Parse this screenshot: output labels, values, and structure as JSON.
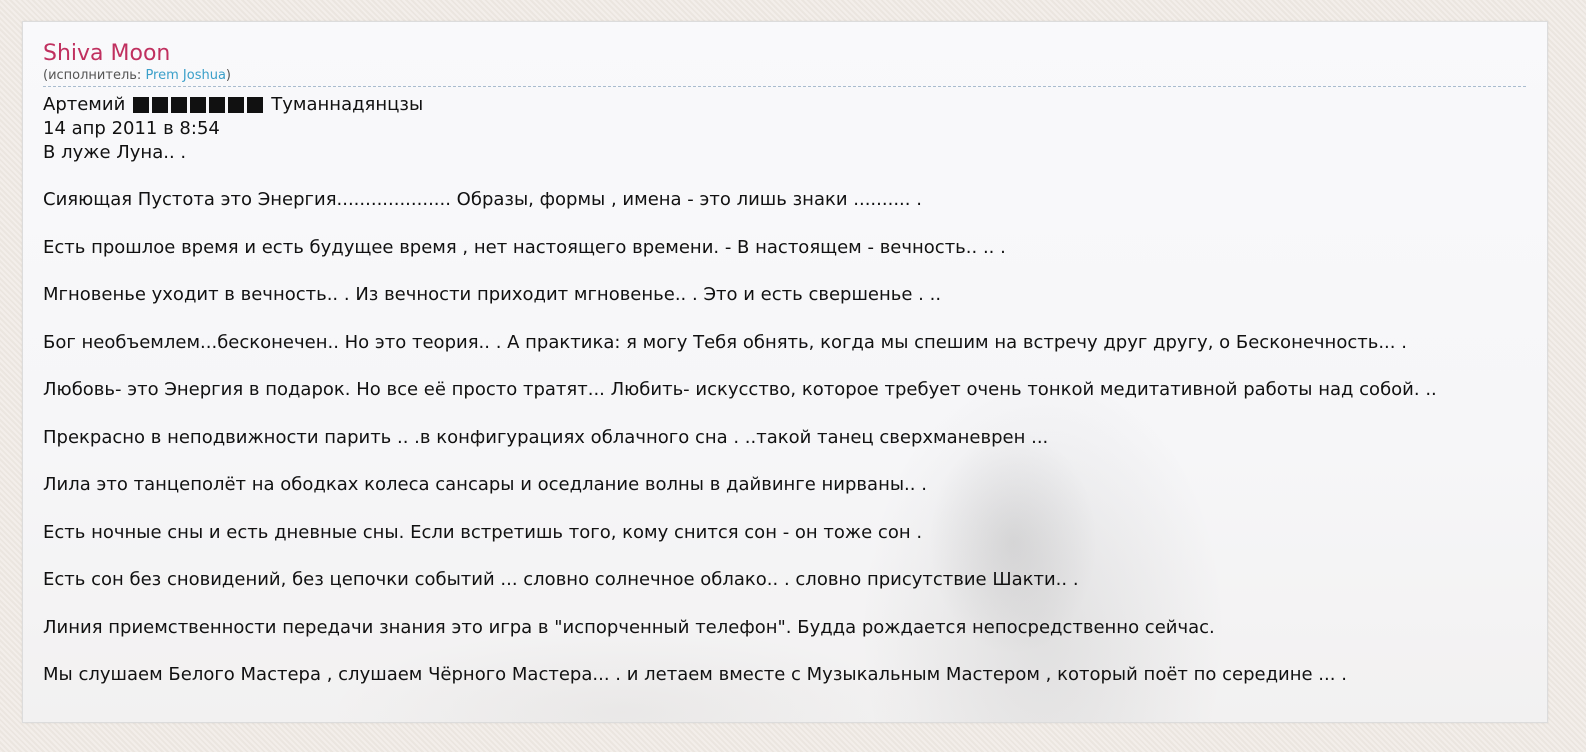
{
  "song": {
    "title": "Shiva Moon",
    "performer_prefix": "(исполнитель: ",
    "performer_name": "Prem Joshua",
    "performer_suffix": ")"
  },
  "post": {
    "author_first": "Артемий",
    "author_last": "Туманнадянцзы",
    "date": "14 апр 2011 в 8:54",
    "lines": [
      "В луже Луна.. .",
      "Сияющая Пустота это Энергия.................... Образы, формы , имена - это лишь знаки .......... .",
      "Есть прошлое время и есть будущее время , нет настоящего времени. - В настоящем - вечность.. .. .",
      "Мгновенье уходит в вечность.. . Из вечности приходит мгновенье.. . Это и есть свершенье . ..",
      "Бог необъемлем...бесконечен.. Но это теория.. . А практика: я могу Тебя обнять, когда мы спешим на встречу друг другу, о Бесконечность... .",
      "Любовь- это Энергия в подарок. Но все её просто тратят... Любить- искусство, которое требует очень тонкой медитативной работы над собой. ..",
      "Прекрасно в неподвижности парить .. .в конфигурациях облачного сна . ..такой танец сверхманеврен ...",
      "Лила это танцеполёт на ободках колеса сансары и оседлание волны в дайвинге нирваны.. .",
      "Есть ночные сны и есть дневные сны. Если встретишь того, кому снится сон - он тоже сон .",
      "Есть сон без сновидений, без цепочки событий ... словно солнечное облако.. . словно присутствие Шакти.. .",
      "Линия приемственности передачи знания это игра в \"испорченный телефон\". Будда рождается непосредственно сейчас.",
      "Мы слушаем Белого Мастера , слушаем Чёрного Мастера... . и летаем вместе с Музыкальным Мастером , который поёт по середине ... ."
    ]
  },
  "colors": {
    "title": "#c0305f",
    "link": "#3a9fc9",
    "text": "#111111",
    "divider": "#a9bccf"
  }
}
